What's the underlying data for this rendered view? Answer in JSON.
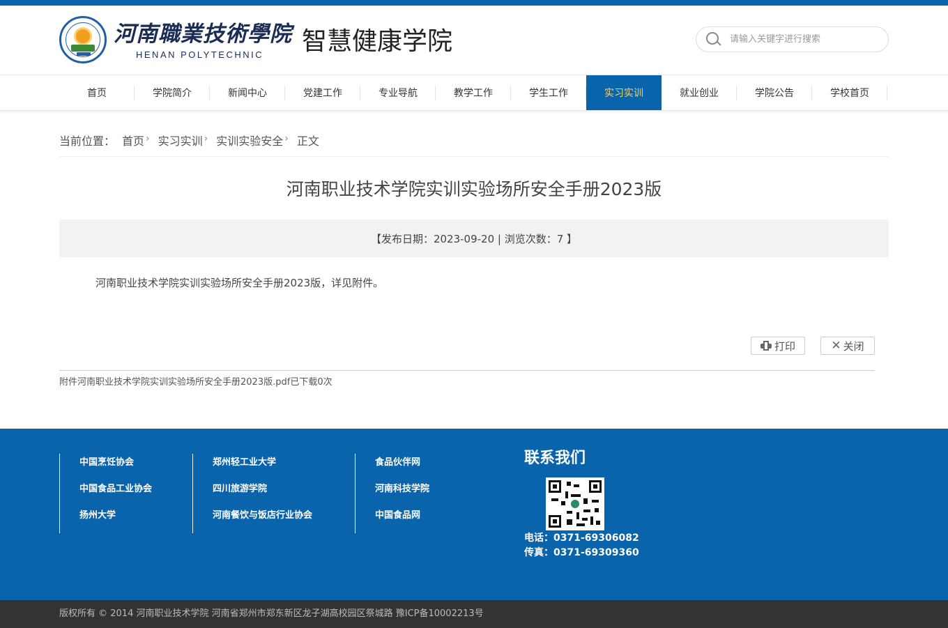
{
  "header": {
    "school_name_cn": "河南職業技術學院",
    "school_name_en": "HENAN POLYTECHNIC",
    "dept_name": "智慧健康学院",
    "search_placeholder": "请输入关键字进行搜索"
  },
  "nav": {
    "items": [
      {
        "label": "首页"
      },
      {
        "label": "学院简介"
      },
      {
        "label": "新闻中心"
      },
      {
        "label": "党建工作"
      },
      {
        "label": "专业导航"
      },
      {
        "label": "教学工作"
      },
      {
        "label": "学生工作"
      },
      {
        "label": "实习实训"
      },
      {
        "label": "就业创业"
      },
      {
        "label": "学院公告"
      },
      {
        "label": "学校首页"
      }
    ],
    "active_label": "实习实训"
  },
  "breadcrumb": {
    "prefix": "当前位置：",
    "items": [
      "首页",
      "实习实训",
      "实训实验安全",
      "正文"
    ],
    "sep": "›"
  },
  "article": {
    "title": "河南职业技术学院实训实验场所安全手册2023版",
    "meta": "【发布日期：2023-09-20 | 浏览次数：7 】",
    "body": "河南职业技术学院实训实验场所安全手册2023版，详见附件。",
    "print_label": "打印",
    "close_label": "关闭",
    "attachment_prefix": "附件",
    "attachment_name": "河南职业技术学院实训实验场所安全手册2023版.pdf",
    "attachment_suffix": "已下载0次"
  },
  "footer": {
    "links_col1": [
      "中国烹饪协会",
      "中国食品工业协会",
      "扬州大学"
    ],
    "links_col2": [
      "郑州轻工业大学",
      "四川旅游学院",
      "河南餐饮与饭店行业协会"
    ],
    "links_col3": [
      "食品伙伴网",
      "河南科技学院",
      "中国食品网"
    ],
    "contact_title": "联系我们",
    "phone": "电话：0371-69306082",
    "fax": "传真：0371-69309360"
  },
  "copyright": "版权所有 © 2014 河南职业技术学院 河南省郑州市郑东新区龙子湖高校园区祭城路 豫ICP备10002213号",
  "colors": {
    "brand_blue": "#0a64ac",
    "nav_active_text": "#f5d26a",
    "bottom_bar": "#333333"
  }
}
